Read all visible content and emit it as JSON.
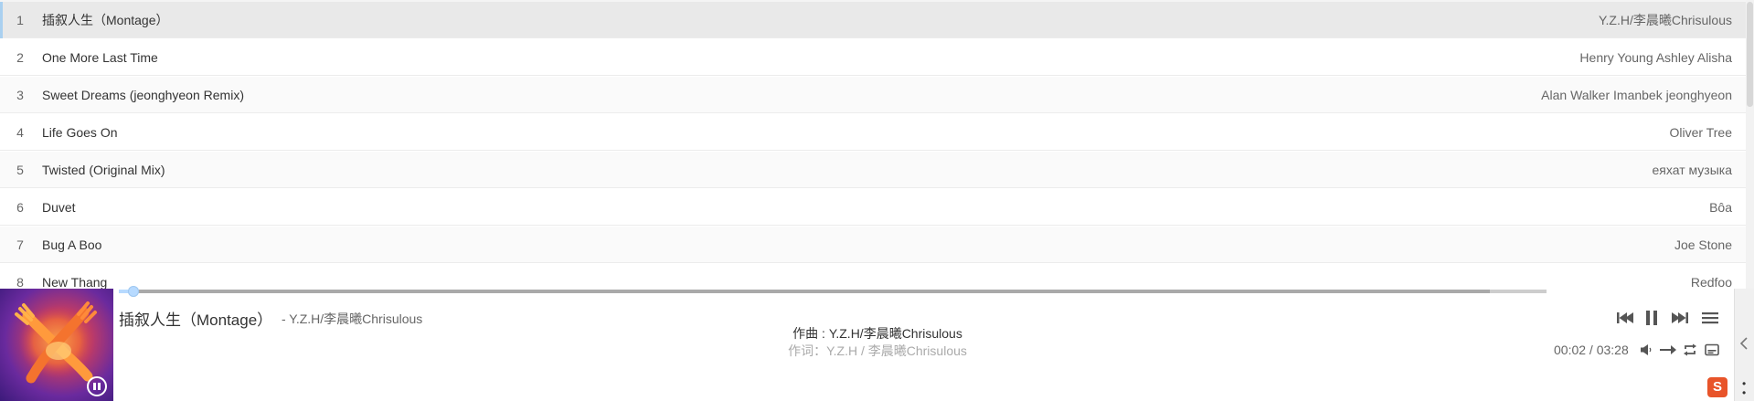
{
  "playlist": {
    "tracks": [
      {
        "num": "1",
        "title": "插叙人生（Montage）",
        "artist": "Y.Z.H/李晨曦Chrisulous"
      },
      {
        "num": "2",
        "title": "One More Last Time",
        "artist": "Henry Young Ashley Alisha"
      },
      {
        "num": "3",
        "title": "Sweet Dreams (jeonghyeon Remix)",
        "artist": "Alan Walker Imanbek jeonghyeon"
      },
      {
        "num": "4",
        "title": "Life Goes On",
        "artist": "Oliver Tree"
      },
      {
        "num": "5",
        "title": "Twisted (Original Mix)",
        "artist": "еяхат музыка"
      },
      {
        "num": "6",
        "title": "Duvet",
        "artist": "Bôa"
      },
      {
        "num": "7",
        "title": "Bug A Boo",
        "artist": "Joe Stone"
      },
      {
        "num": "8",
        "title": "New Thang",
        "artist": "Redfoo"
      }
    ],
    "active_index": 0
  },
  "player": {
    "song_title": "插叙人生（Montage）",
    "song_artist": "- Y.Z.H/李晨曦Chrisulous",
    "lyric_current": "作曲 : Y.Z.H/李晨曦Chrisulous",
    "lyric_next": "作词：Y.Z.H / 李晨曦Chrisulous",
    "time": "00:02 / 03:28",
    "progress_played_fraction": 0.01,
    "progress_loaded_fraction": 0.96,
    "icons": {
      "prev": "skip-back-icon",
      "pause": "pause-icon",
      "next": "skip-forward-icon",
      "menu": "list-menu-icon",
      "volume": "volume-icon",
      "order": "order-icon",
      "loop": "loop-icon",
      "lyrics": "lyrics-icon"
    },
    "colors": {
      "accent": "#b7daff",
      "active_row": "#e9e9e9"
    }
  }
}
